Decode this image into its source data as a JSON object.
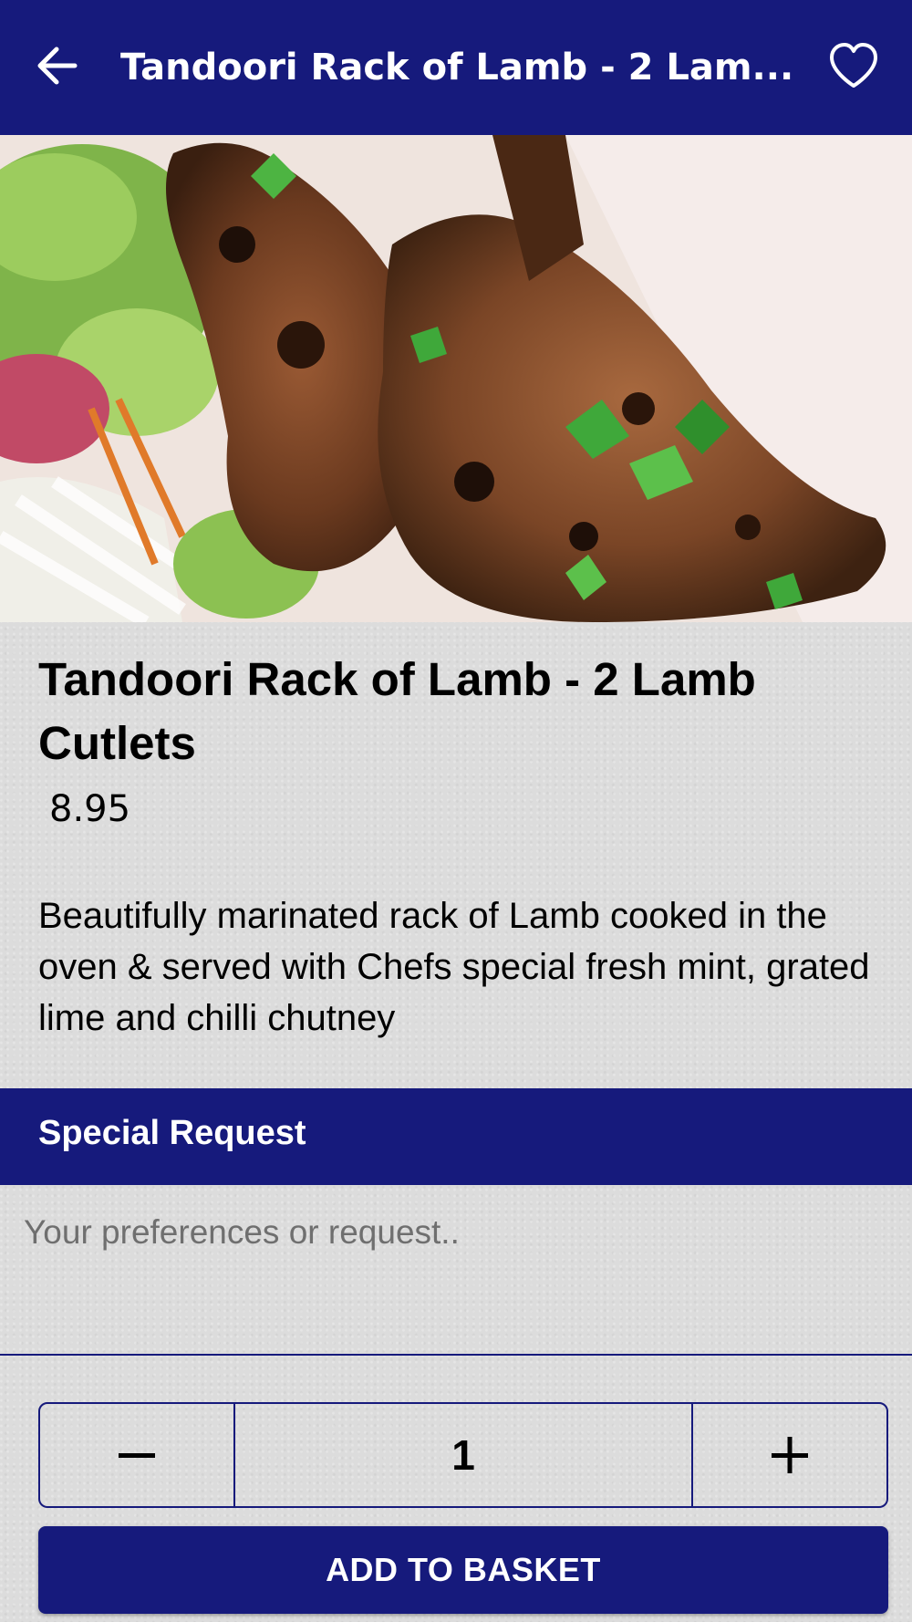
{
  "appbar": {
    "title": "Tandoori Rack of Lamb - 2 Lam...",
    "back_icon": "arrow-left-icon",
    "favorite_icon": "heart-outline-icon"
  },
  "hero": {
    "image_subject": "grilled tandoori lamb cutlets with salad"
  },
  "item": {
    "name": "Tandoori Rack of Lamb - 2 Lamb Cutlets",
    "price": "8.95",
    "description": "Beautifully marinated rack of Lamb cooked in the oven & served with Chefs special fresh mint, grated lime and chilli chutney"
  },
  "special_request": {
    "title": "Special Request",
    "placeholder": "Your preferences or request.."
  },
  "quantity": {
    "value": "1",
    "minus_icon": "minus-icon",
    "plus_icon": "plus-icon"
  },
  "add_button": {
    "label": "ADD TO BASKET"
  },
  "colors": {
    "primary": "#161a7c",
    "background": "#dcdcdc"
  }
}
